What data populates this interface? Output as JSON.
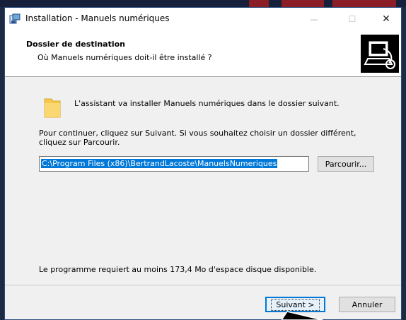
{
  "window": {
    "title": "Installation - Manuels numériques",
    "minimize_glyph": "—",
    "maximize_glyph": "☐",
    "close_glyph": "✕"
  },
  "header": {
    "title": "Dossier de destination",
    "subtitle": "Où Manuels numériques doit-il être installé ?"
  },
  "body": {
    "intro": "L'assistant va installer Manuels numériques dans le dossier suivant.",
    "instructions": "Pour continuer, cliquez sur Suivant. Si vous souhaitez choisir un dossier différent, cliquez sur Parcourir.",
    "path_value": "C:\\Program Files (x86)\\BertrandLacoste\\ManuelsNumeriques",
    "browse_label": "Parcourir...",
    "disk_space": "Le programme requiert au moins 173,4 Mo d'espace disque disponible."
  },
  "footer": {
    "next_label": "Suivant >",
    "cancel_label": "Annuler"
  },
  "icons": {
    "app": "installer-icon",
    "folder": "folder-icon",
    "logo": "computer-install-icon"
  },
  "colors": {
    "accent": "#0078d7",
    "folder": "#f5c74a"
  }
}
